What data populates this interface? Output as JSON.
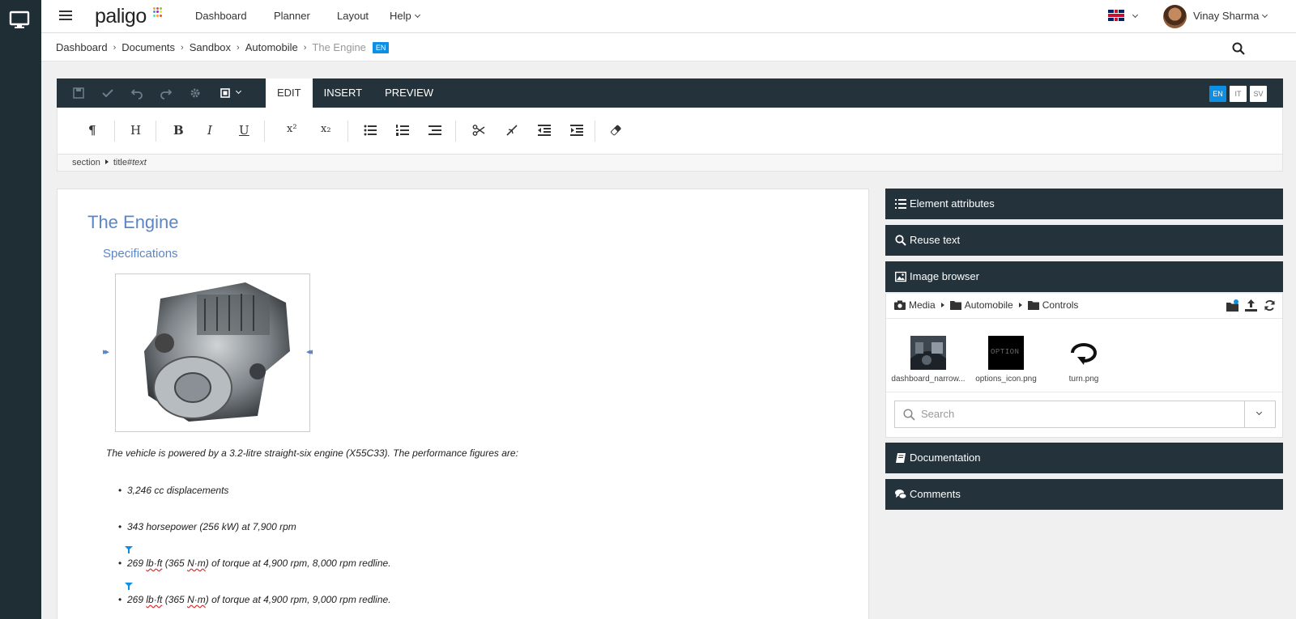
{
  "app": {
    "logo": "paligo",
    "logo_dot_colors": [
      "#f5a623",
      "#e94e3c",
      "#7ed321",
      "#4a90e2",
      "#bd10e0",
      "#f8e71c",
      "#50e3c2",
      "#f5a623",
      "#e94e3c"
    ]
  },
  "topnav": {
    "items": [
      {
        "label": "Dashboard"
      },
      {
        "label": "Planner"
      },
      {
        "label": "Layout"
      },
      {
        "label": "Help"
      }
    ],
    "user_name": "Vinay Sharma"
  },
  "breadcrumb": {
    "items": [
      "Dashboard",
      "Documents",
      "Sandbox",
      "Automobile"
    ],
    "current": "The Engine",
    "language_badge": "EN"
  },
  "editor": {
    "tabs": [
      {
        "label": "EDIT",
        "active": true
      },
      {
        "label": "INSERT",
        "active": false
      },
      {
        "label": "PREVIEW",
        "active": false
      }
    ],
    "languages": [
      {
        "code": "EN",
        "active": true
      },
      {
        "code": "IT",
        "active": false
      },
      {
        "code": "SV",
        "active": false
      }
    ],
    "format_buttons": [
      "¶",
      "H",
      "B",
      "I",
      "U",
      "x²",
      "x₂"
    ],
    "element_path": {
      "parent": "section",
      "current": "title#",
      "current_em": "text"
    }
  },
  "document": {
    "title": "The Engine",
    "subtitle": "Specifications",
    "intro": "The vehicle is powered by a 3.2-litre straight-six engine (X55C33). The performance figures are:",
    "bullets": [
      {
        "pre": "3,246 cc displacements",
        "u1": "",
        "mid": "",
        "u2": "",
        "post": ""
      },
      {
        "pre": "343 horsepower (256 kW) at 7,900 rpm",
        "u1": "",
        "mid": "",
        "u2": "",
        "post": ""
      },
      {
        "pre": "269 ",
        "u1": "lb·ft",
        "mid": " (365 ",
        "u2": "N·m",
        "post": ") of torque at 4,900 rpm, 8,000 rpm redline."
      },
      {
        "pre": "269 ",
        "u1": "lb·ft",
        "mid": " (365 ",
        "u2": "N·m",
        "post": ") of torque at 4,900 rpm, 9,000 rpm redline."
      }
    ]
  },
  "side_panels": {
    "element_attributes": "Element attributes",
    "reuse_text": "Reuse text",
    "image_browser": {
      "title": "Image browser",
      "path": [
        "Media",
        "Automobile",
        "Controls"
      ],
      "thumbnails": [
        {
          "label": "dashboard_narrow..."
        },
        {
          "label": "options_icon.png",
          "overlay": "OPTION"
        },
        {
          "label": "turn.png"
        }
      ],
      "search_placeholder": "Search"
    },
    "documentation": "Documentation",
    "comments": "Comments"
  },
  "colors": {
    "dark_bar": "#23323b",
    "rail": "#1f2d35",
    "accent_blue": "#0d8fe6",
    "heading_blue": "#5b86c5"
  }
}
